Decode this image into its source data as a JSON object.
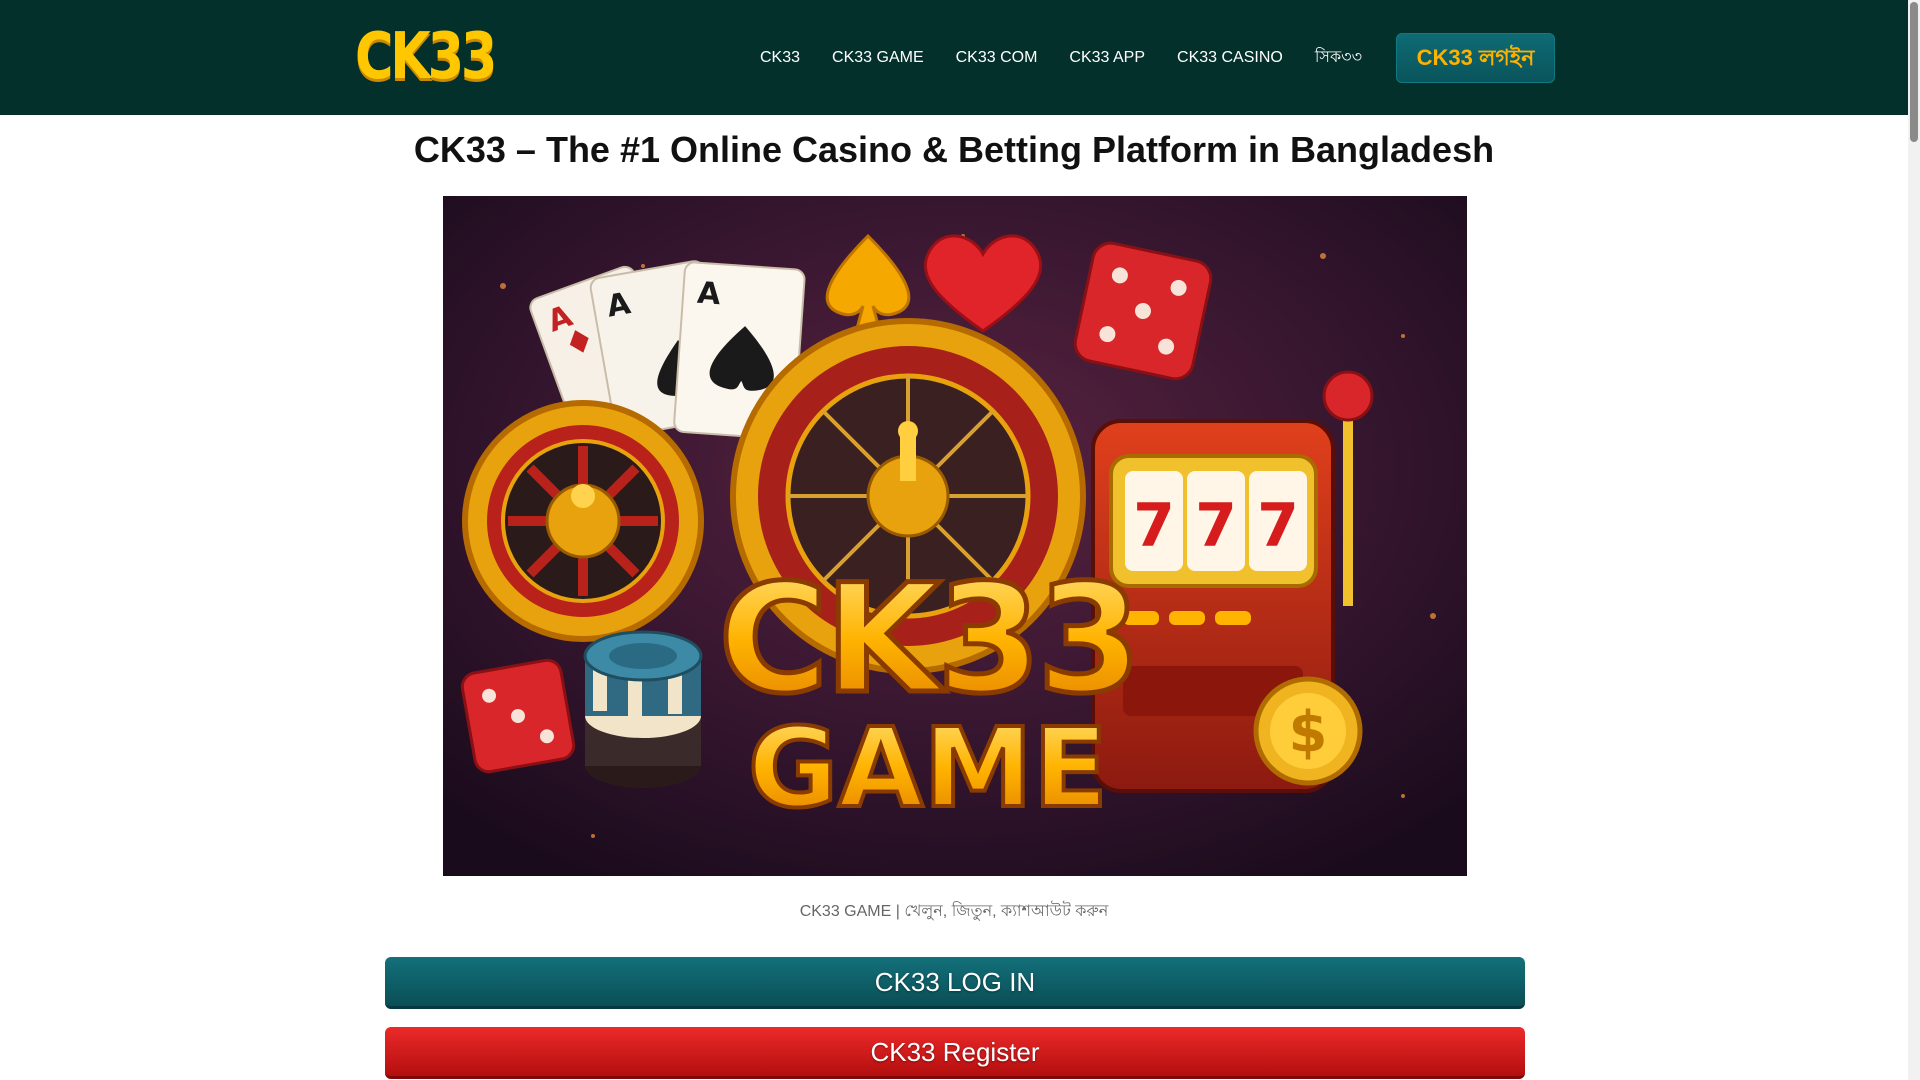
{
  "header": {
    "logo_text": "CK33",
    "nav_items": [
      {
        "label": "CK33"
      },
      {
        "label": "CK33 GAME"
      },
      {
        "label": "CK33 COM"
      },
      {
        "label": "CK33 APP"
      },
      {
        "label": "CK33 CASINO"
      },
      {
        "label": "সিক৩৩"
      }
    ],
    "login_button": "CK33 লগইন"
  },
  "main": {
    "title": "CK33 – The #1 Online Casino & Betting Platform in Bangladesh",
    "hero_image": {
      "line1": "CK33",
      "line2": "GAME",
      "card_rank": "A",
      "slot_reels": [
        "7",
        "7",
        "7"
      ],
      "coin_symbol": "$"
    },
    "caption": "CK33 GAME | খেলুন, জিতুন, ক্যাশআউট করুন",
    "login_cta": "CK33 LOG IN",
    "register_cta": "CK33 Register"
  },
  "colors": {
    "header_bg": "#04302b",
    "logo": "#ffc700",
    "login_teal": "#0e6b74",
    "register_red": "#d41a1a",
    "hero_bg": "#3a1732"
  }
}
